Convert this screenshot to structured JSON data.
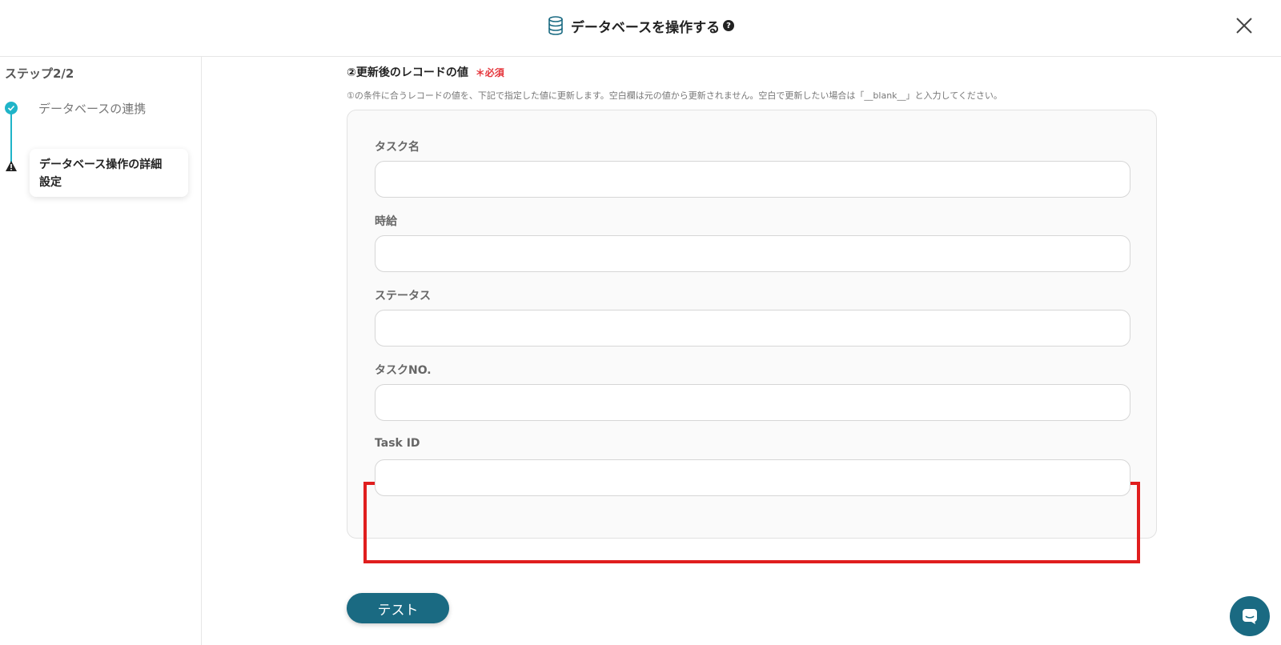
{
  "header": {
    "title": "データベースを操作する",
    "help_symbol": "?",
    "icon": "database-icon",
    "close_icon": "close-icon"
  },
  "sidebar": {
    "step_count": "ステップ2/2",
    "steps": [
      {
        "label": "データベースの連携",
        "status": "complete"
      },
      {
        "label": "データベース操作の詳細",
        "label_line2": "設定",
        "status": "warning"
      }
    ]
  },
  "main": {
    "section_title": "②更新後のレコードの値",
    "required_label": "＊必須",
    "description": "①の条件に合うレコードの値を、下記で指定した値に更新します。空白欄は元の値から更新されません。空白で更新したい場合は「__blank__」と入力してください。",
    "fields": [
      {
        "label": "タスク名",
        "value": ""
      },
      {
        "label": "時給",
        "value": ""
      },
      {
        "label": "ステータス",
        "value": ""
      },
      {
        "label": "タスクNO.",
        "value": ""
      },
      {
        "label": "Task ID",
        "value": ""
      }
    ],
    "test_button": "テスト"
  },
  "colors": {
    "accent": "#1a6a82",
    "step_complete": "#1fb4c8",
    "required": "#e5353b",
    "highlight": "#e01e1e"
  }
}
